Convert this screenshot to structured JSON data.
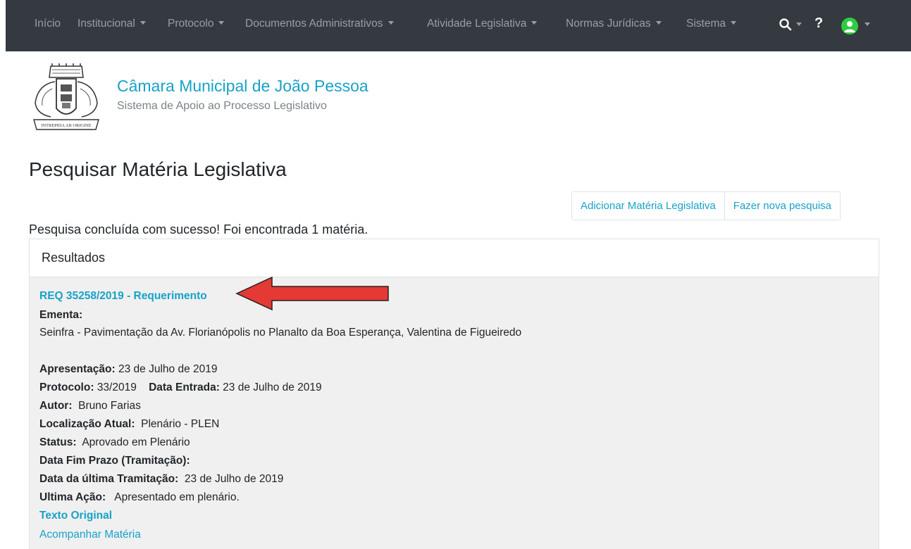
{
  "nav": {
    "items": [
      {
        "label": "Início",
        "dropdown": false
      },
      {
        "label": "Institucional",
        "dropdown": true
      },
      {
        "label": "Protocolo",
        "dropdown": true
      },
      {
        "label": "Documentos Administrativos",
        "dropdown": true
      },
      {
        "label": "Atividade Legislativa",
        "dropdown": true
      },
      {
        "label": "Normas Jurídicas",
        "dropdown": true
      },
      {
        "label": "Sistema",
        "dropdown": true
      }
    ],
    "help_label": "?",
    "icons": [
      "search-icon",
      "help-icon",
      "user-avatar-icon"
    ],
    "avatar_color": "#2ecc40"
  },
  "header": {
    "title": "Câmara Municipal de João Pessoa",
    "subtitle": "Sistema de Apoio ao Processo Legislativo",
    "logo_motto": "INTREPIDA AB ORIGINE"
  },
  "page": {
    "title": "Pesquisar Matéria Legislativa",
    "buttons": {
      "add": "Adicionar Matéria Legislativa",
      "new_search": "Fazer nova pesquisa"
    },
    "success_message": "Pesquisa concluída com sucesso! Foi encontrada 1 matéria."
  },
  "results": {
    "header": "Resultados",
    "item": {
      "title": "REQ 35258/2019 - Requerimento",
      "ementa_label": "Ementa:",
      "ementa": "Seinfra - Pavimentação da Av. Florianópolis no Planalto da Boa Esperança, Valentina de Figueiredo",
      "apresentacao_label": "Apresentação:",
      "apresentacao": "23 de Julho de 2019",
      "protocolo_label": "Protocolo:",
      "protocolo": "33/2019",
      "data_entrada_label": "Data Entrada:",
      "data_entrada": "23 de Julho de 2019",
      "autor_label": "Autor:",
      "autor": "Bruno Farias",
      "localizacao_label": "Localização Atual:",
      "localizacao": "Plenário - PLEN",
      "status_label": "Status:",
      "status": "Aprovado em Plenário",
      "data_fim_label": "Data Fim Prazo (Tramitação):",
      "data_ultima_label": "Data da última Tramitação:",
      "data_ultima": "23 de Julho de 2019",
      "ultima_acao_label": "Ultima Ação:",
      "ultima_acao": "Apresentado em plenário.",
      "texto_original": "Texto Original",
      "acompanhar": "Acompanhar Matéria"
    }
  },
  "colors": {
    "navbar": "#343a40",
    "link": "#17a2c8",
    "annotation_arrow": "#e53935"
  }
}
